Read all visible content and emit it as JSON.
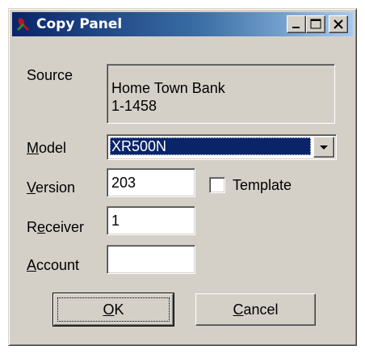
{
  "window": {
    "title": "Copy Panel",
    "controls": {
      "minimize_icon": "minimize-icon",
      "maximize_icon": "maximize-icon",
      "close_icon": "close-icon"
    }
  },
  "source": {
    "label": "Source",
    "lines": [
      "Home Town Bank",
      "1-1458"
    ]
  },
  "model": {
    "label_accel": "M",
    "label_rest": "odel",
    "value": "XR500N"
  },
  "version": {
    "label_accel": "V",
    "label_rest": "ersion",
    "value": "203"
  },
  "template": {
    "label": "Template",
    "checked": false
  },
  "receiver": {
    "label_pre": "R",
    "label_accel": "e",
    "label_rest": "ceiver",
    "value": "1"
  },
  "account": {
    "label_accel": "A",
    "label_rest": "ccount",
    "value": ""
  },
  "buttons": {
    "ok_accel": "O",
    "ok_rest": "K",
    "cancel_accel": "C",
    "cancel_rest": "ancel"
  },
  "colors": {
    "face": "#d4d0c8",
    "title_start": "#0a246a",
    "title_end": "#a6caf0",
    "selection": "#0a246a"
  }
}
